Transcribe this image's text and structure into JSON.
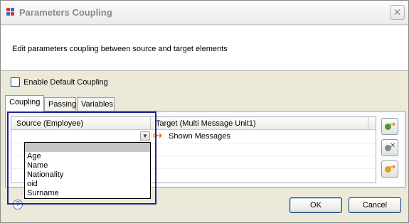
{
  "window": {
    "title": "Parameters Coupling",
    "close_glyph": "✕",
    "app_icon": "app-logo-icon"
  },
  "description": "Edit parameters coupling between source and target elements",
  "enable_default_coupling": {
    "label": "Enable Default Coupling",
    "checked": false
  },
  "tabs": [
    {
      "label": "Coupling",
      "active": true
    },
    {
      "label": "Passing",
      "active": false
    },
    {
      "label": "Variables",
      "active": false
    }
  ],
  "table": {
    "columns": [
      "Source (Employee)",
      "Target (Multi Message Unit1)"
    ],
    "rows": [
      {
        "source": "",
        "target": "Shown Messages"
      }
    ]
  },
  "source_dropdown": {
    "options": [
      "",
      "Age",
      "Name",
      "Nationality",
      "oid",
      "Surname"
    ],
    "selected_index": 0
  },
  "side_buttons": [
    {
      "name": "add-coupling-button",
      "icon": "gear-add-icon"
    },
    {
      "name": "remove-coupling-button",
      "icon": "gear-remove-icon"
    },
    {
      "name": "edit-coupling-button",
      "icon": "gear-arrow-icon"
    }
  ],
  "buttons": {
    "ok": "OK",
    "cancel": "Cancel",
    "help_glyph": "?"
  },
  "colors": {
    "highlight_frame": "#1d239b",
    "dialog_background": "#ece9d8"
  }
}
